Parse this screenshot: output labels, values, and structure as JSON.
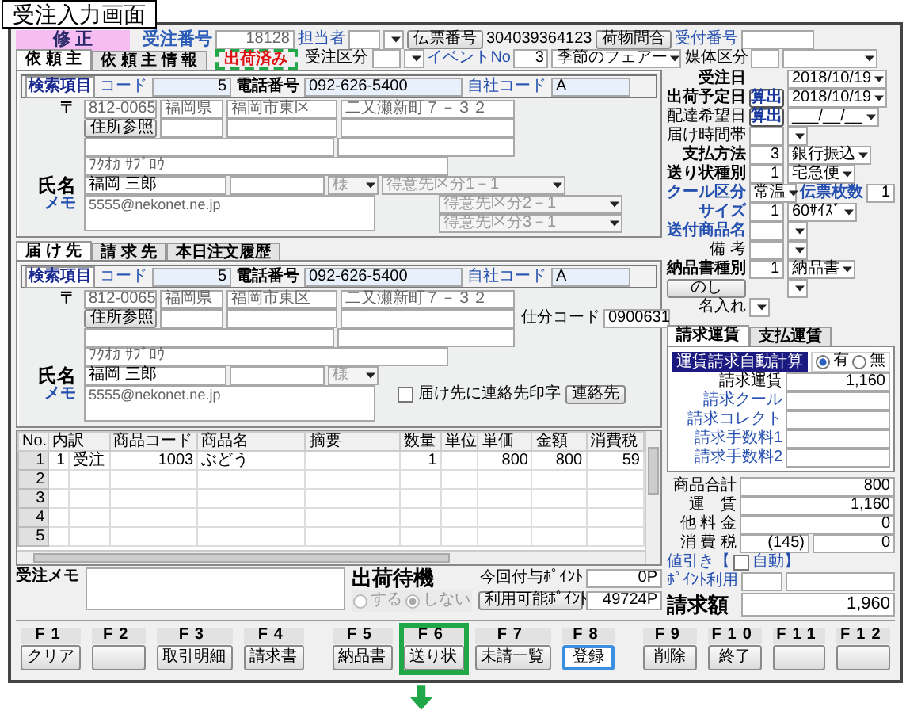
{
  "caption": "受注入力画面",
  "header": {
    "mode": "修 正",
    "order_no_label": "受注番号",
    "order_no": "18128",
    "staff_label": "担当者",
    "slip_button": "伝票番号",
    "slip_no": "304039364123",
    "tracking_button": "荷物問合",
    "receipt_label": "受付番号",
    "status_badge": {
      "label": "出荷済み",
      "annotated": true
    },
    "order_type_label": "受注区分",
    "event_label": "イベントNo",
    "event_no": "3",
    "event_name": "季節のフェアー",
    "media_label": "媒体区分"
  },
  "client_tabs": [
    {
      "label": "依 頼 主",
      "selected": true
    },
    {
      "label": "依 頼 主 情 報",
      "selected": false
    }
  ],
  "client": {
    "search_label": "検索項目",
    "code_label": "コード",
    "code": "5",
    "phone_label": "電話番号",
    "phone": "092-626-5400",
    "own_code_label": "自社コード",
    "own_code": "A",
    "postal_mark": "〒",
    "postal": "812-0065",
    "prefecture": "福岡県",
    "city": "福岡市東区",
    "street": "二又瀬新町７－３２",
    "address_button": "住所参照",
    "kana": "ﾌｸｵｶ ｻﾌﾞﾛｳ",
    "name_label": "氏名",
    "name": "福岡 三郎",
    "honorific": "様",
    "memo_label": "メモ",
    "memo": "5555@nekonet.ne.jp",
    "categories": [
      {
        "label": "得意先区分1－1",
        "disabled": true
      },
      {
        "label": "得意先区分2－1",
        "disabled": true
      },
      {
        "label": "得意先区分3－1",
        "disabled": true
      }
    ]
  },
  "ship_tabs": [
    {
      "label": "届 け 先",
      "selected": true
    },
    {
      "label": "請 求 先",
      "selected": false
    },
    {
      "label": "本日注文履歴",
      "selected": false
    }
  ],
  "ship_to": {
    "search_label": "検索項目",
    "code_label": "コード",
    "code": "5",
    "phone_label": "電話番号",
    "phone": "092-626-5400",
    "own_code_label": "自社コード",
    "own_code": "A",
    "postal_mark": "〒",
    "postal": "812-0065",
    "prefecture": "福岡県",
    "city": "福岡市東区",
    "street": "二又瀬新町７－３２",
    "address_button": "住所参照",
    "kana": "ﾌｸｵｶ ｻﾌﾞﾛｳ",
    "name_label": "氏名",
    "name": "福岡 三郎",
    "honorific": "様",
    "memo_label": "メモ",
    "memo": "5555@nekonet.ne.jp",
    "sort_code_label": "仕分コード",
    "sort_code": "0900631",
    "print_contact": {
      "label": "届け先に連絡先印字",
      "checked": false
    },
    "contact_button": "連絡先"
  },
  "order_info": [
    {
      "kind": "select",
      "label": "受注日",
      "value": "2018/10/19"
    },
    {
      "kind": "select",
      "label": "出荷予定日",
      "calc_button": "算出",
      "value": "2018/10/19"
    },
    {
      "kind": "select",
      "label": "配達希望日",
      "calc_button": "算出",
      "value": "___/__/__"
    },
    {
      "kind": "code_select",
      "label": "届け時間帯"
    },
    {
      "kind": "code_select",
      "label": "支払方法",
      "code": "3",
      "value": "銀行振込"
    },
    {
      "kind": "code_select",
      "label": "送り状種別",
      "code": "1",
      "value": "宅急便"
    },
    {
      "kind": "cool",
      "label": "クール区分",
      "value": "常温",
      "count_label": "伝票枚数",
      "count": "1"
    },
    {
      "kind": "code_select",
      "label": "サイズ",
      "code": "1",
      "value": "60ｻｲｽﾞ"
    },
    {
      "kind": "code_select",
      "label": "送付商品名"
    },
    {
      "kind": "code_select",
      "label": "備 考"
    },
    {
      "kind": "code_select",
      "label": "納品書種別",
      "code": "1",
      "value": "納品書"
    },
    {
      "kind": "button_select",
      "button": "のし"
    },
    {
      "kind": "wide_select",
      "label": "名入れ"
    }
  ],
  "fee_tabs": [
    {
      "label": "請求運賃",
      "selected": true
    },
    {
      "label": "支払運賃",
      "selected": false
    }
  ],
  "auto_calc": {
    "label": "運賃請求自動計算",
    "options": [
      {
        "label": "有",
        "selected": true
      },
      {
        "label": "無",
        "selected": false
      }
    ]
  },
  "fees": [
    {
      "label": "請求運賃",
      "value": "1,160"
    },
    {
      "label": "請求クール"
    },
    {
      "label": "請求コレクト"
    },
    {
      "label": "請求手数料1"
    },
    {
      "label": "請求手数料2"
    }
  ],
  "items_table": {
    "columns": [
      "No.",
      "内訳",
      "商品コード",
      "商品名",
      "摘要",
      "数量",
      "単位",
      "単価",
      "金額",
      "消費税"
    ],
    "rows": [
      {
        "no": "1",
        "cells": [
          "1",
          "受注",
          "1003",
          "ぶどう",
          null,
          "1",
          null,
          "800",
          "800",
          "59"
        ]
      },
      {
        "no": "2"
      },
      {
        "no": "3"
      },
      {
        "no": "4"
      },
      {
        "no": "5"
      }
    ]
  },
  "totals": {
    "rows": [
      {
        "label": "商品合計",
        "value": "800"
      },
      {
        "label": "運　賃",
        "value": "1,160"
      },
      {
        "label": "他 料 金",
        "value": "0"
      },
      {
        "label": "消 費 税",
        "sub_value": "(145)",
        "value": "0"
      }
    ],
    "discount_open": "値引き【",
    "discount_checkbox": {
      "checked": false
    },
    "discount_close": "自動】",
    "points_label": "ﾎﾟｲﾝﾄ利用",
    "billing_label": "請求額",
    "billing": "1,960"
  },
  "order_memo_label": "受注メモ",
  "shipping_hold": {
    "title": "出荷待機",
    "disabled": true,
    "options": [
      {
        "label": "する",
        "selected": false
      },
      {
        "label": "しない",
        "selected": true
      }
    ]
  },
  "points": {
    "granted_label": "今回付与ﾎﾟｲﾝﾄ",
    "granted": "0P",
    "available_button": "利用可能ﾎﾟｲﾝﾄ",
    "available": "49724P"
  },
  "function_keys": [
    {
      "key": "F1",
      "label": "クリア",
      "focused": false
    },
    {
      "key": "F2",
      "focused": false
    },
    {
      "key": "F3",
      "label": "取引明細",
      "focused": false
    },
    {
      "key": "F4",
      "label": "請求書",
      "focused": false
    },
    {
      "key": "F5",
      "label": "納品書",
      "focused": false
    },
    {
      "key": "F6",
      "label": "送り状",
      "focused": false,
      "annotated": true
    },
    {
      "key": "F7",
      "label": "未請一覧",
      "focused": false
    },
    {
      "key": "F8",
      "label": "登録",
      "focused": true
    },
    {
      "key": "F9",
      "label": "削除",
      "focused": false
    },
    {
      "key": "F10",
      "label": "終了",
      "focused": false
    },
    {
      "key": "F11",
      "focused": false
    },
    {
      "key": "F12",
      "focused": false
    }
  ]
}
